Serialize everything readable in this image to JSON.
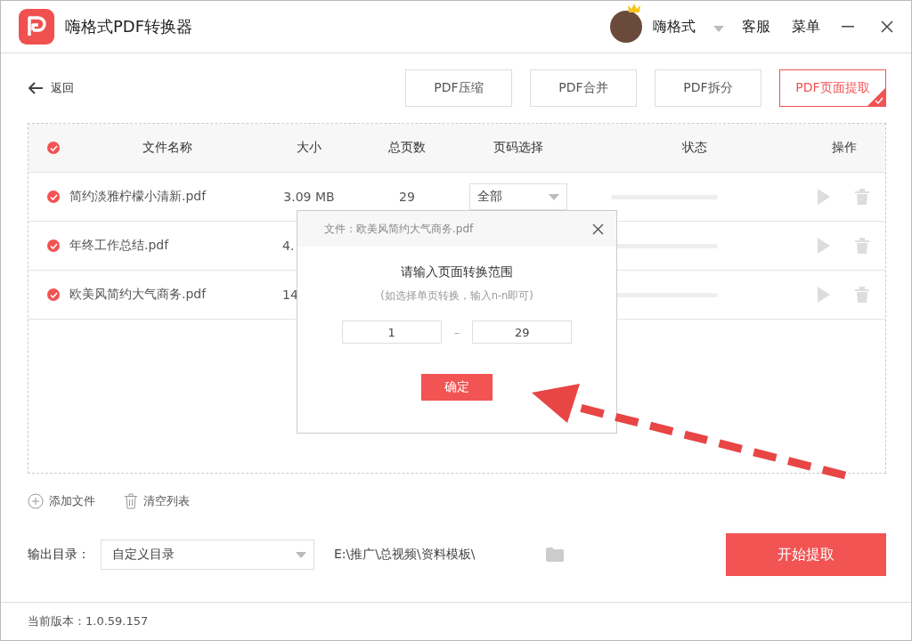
{
  "app": {
    "title": "嗨格式PDF转换器"
  },
  "user": {
    "name": "嗨格式"
  },
  "header_links": [
    "客服",
    "菜单"
  ],
  "back": "返回",
  "tools": [
    {
      "label": "PDF压缩",
      "selected": false
    },
    {
      "label": "PDF合并",
      "selected": false
    },
    {
      "label": "PDF拆分",
      "selected": false
    },
    {
      "label": "PDF页面提取",
      "selected": true
    }
  ],
  "table": {
    "all_checked": true,
    "columns": [
      "文件名称",
      "大小",
      "总页数",
      "页码选择",
      "状态",
      "操作"
    ],
    "rows": [
      {
        "checked": true,
        "name": "简约淡雅柠檬小清新.pdf",
        "size": "3.09 MB",
        "pages": "29",
        "page_select": "全部",
        "level": 0
      },
      {
        "checked": true,
        "name": "年终工作总结.pdf",
        "size": "4.",
        "level": 0
      },
      {
        "checked": true,
        "name": "欧美风简约大气商务.pdf",
        "size": "14",
        "level": 0
      }
    ]
  },
  "dialog": {
    "title": "文件：欧美风简约大气商务.pdf",
    "prompt": "请输入页面转换范围",
    "hint": "(如选择单页转换，输入n-n即可)",
    "from": "1",
    "separator": "–",
    "to": "29",
    "confirm": "确定"
  },
  "file_actions": [
    {
      "kind": "add",
      "label": "添加文件"
    },
    {
      "kind": "clear",
      "label": "清空列表"
    }
  ],
  "output": {
    "label": "输出目录：",
    "select": "自定义目录",
    "path": "E:\\推广\\总视频\\资料模板\\"
  },
  "start_button": "开始提取",
  "version": "当前版本：1.0.59.157"
}
